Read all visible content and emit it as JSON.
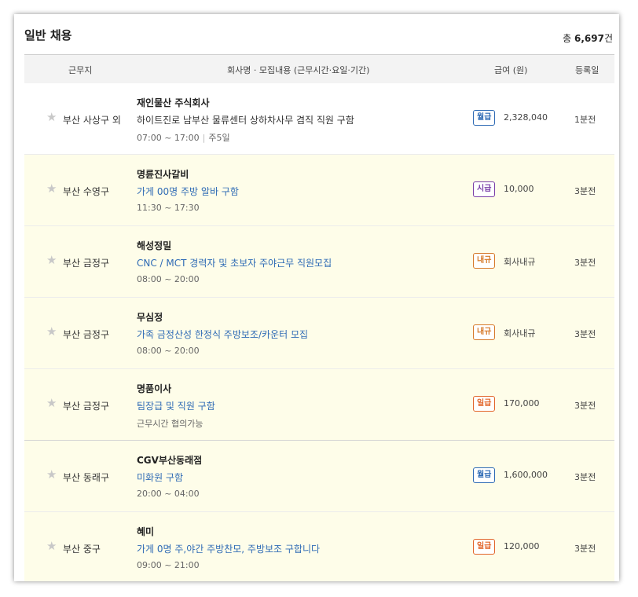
{
  "section": {
    "title": "일반 채용",
    "total_prefix": "총 ",
    "total_count": "6,697",
    "total_suffix": "건"
  },
  "header": {
    "location": "근무지",
    "company": "회사명 · 모집내용 (근무시간·요일·기간)",
    "pay": "급여 (원)",
    "date": "등록일"
  },
  "colors": {
    "monthly": "#2f6bb5",
    "hourly": "#7a3fa8",
    "negotiable": "#d67a2a",
    "daily": "#e2652a",
    "highlight_bg": "#fefde9"
  },
  "rows": [
    {
      "location": "부산 사상구 외",
      "company": "재인물산 주식회사",
      "title": "하이트진로 남부산 물류센터 상하차사무 겸직 직원 구함",
      "time": "07:00 ~ 17:00",
      "days": "주5일",
      "pay_type": "월급",
      "pay": "2,328,040",
      "posted": "1분전"
    },
    {
      "location": "부산 수영구",
      "company": "명륜진사갈비",
      "title": "가게 00명 주방 알바 구함",
      "time": "11:30 ~ 17:30",
      "days": "",
      "pay_type": "시급",
      "pay": "10,000",
      "posted": "3분전"
    },
    {
      "location": "부산 금정구",
      "company": "해성정밀",
      "title": "CNC / MCT 경력자 및 초보자 주야근무 직원모집",
      "time": "08:00 ~ 20:00",
      "days": "",
      "pay_type": "내규",
      "pay": "회사내규",
      "posted": "3분전"
    },
    {
      "location": "부산 금정구",
      "company": "무심정",
      "title": "가족 금정산성 한정식 주방보조/카운터 모집",
      "time": "08:00 ~ 20:00",
      "days": "",
      "pay_type": "내규",
      "pay": "회사내규",
      "posted": "3분전"
    },
    {
      "location": "부산 금정구",
      "company": "명품이사",
      "title": "팀장급 및 직원 구함",
      "time": "근무시간 협의가능",
      "days": "",
      "pay_type": "일급",
      "pay": "170,000",
      "posted": "3분전"
    },
    {
      "location": "부산 동래구",
      "company": "CGV부산동래점",
      "title": "미화원 구함",
      "time": "20:00 ~ 04:00",
      "days": "",
      "pay_type": "월급",
      "pay": "1,600,000",
      "posted": "3분전"
    },
    {
      "location": "부산 중구",
      "company": "혜미",
      "title": "가게 0명 주,야간 주방찬모, 주방보조 구합니다",
      "time": "09:00 ~ 21:00",
      "days": "",
      "pay_type": "일급",
      "pay": "120,000",
      "posted": "3분전"
    }
  ]
}
